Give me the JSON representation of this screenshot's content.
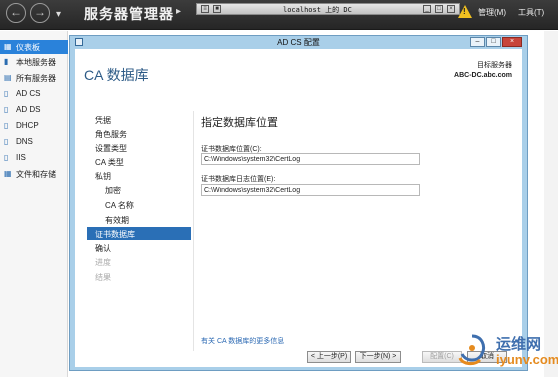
{
  "server_manager": {
    "title": "服务器管理器",
    "manage_menu": "管理(M)",
    "tools_menu": "工具(T)",
    "sidebar": [
      {
        "label": "仪表板",
        "icon": "dashboard-icon",
        "active": true
      },
      {
        "label": "本地服务器",
        "icon": "server-icon",
        "active": false
      },
      {
        "label": "所有服务器",
        "icon": "servers-icon",
        "active": false
      },
      {
        "label": "AD CS",
        "icon": "role-icon",
        "active": false
      },
      {
        "label": "AD DS",
        "icon": "role-icon",
        "active": false
      },
      {
        "label": "DHCP",
        "icon": "role-icon",
        "active": false
      },
      {
        "label": "DNS",
        "icon": "role-icon",
        "active": false
      },
      {
        "label": "IIS",
        "icon": "role-icon",
        "active": false
      },
      {
        "label": "文件和存储",
        "icon": "storage-icon",
        "active": false
      }
    ]
  },
  "remote_session": {
    "title": "localhost 上的 DC"
  },
  "dialog": {
    "title": "AD CS 配置",
    "heading": "CA 数据库",
    "target_label": "目标服务器",
    "target_value": "ABC-DC.abc.com",
    "nav": [
      {
        "label": "凭据",
        "indent": 0,
        "state": "normal"
      },
      {
        "label": "角色服务",
        "indent": 0,
        "state": "normal"
      },
      {
        "label": "设置类型",
        "indent": 0,
        "state": "normal"
      },
      {
        "label": "CA 类型",
        "indent": 0,
        "state": "normal"
      },
      {
        "label": "私钥",
        "indent": 0,
        "state": "normal"
      },
      {
        "label": "加密",
        "indent": 1,
        "state": "normal"
      },
      {
        "label": "CA 名称",
        "indent": 1,
        "state": "normal"
      },
      {
        "label": "有效期",
        "indent": 1,
        "state": "normal"
      },
      {
        "label": "证书数据库",
        "indent": 0,
        "state": "active"
      },
      {
        "label": "确认",
        "indent": 0,
        "state": "normal"
      },
      {
        "label": "进度",
        "indent": 0,
        "state": "disabled"
      },
      {
        "label": "结果",
        "indent": 0,
        "state": "disabled"
      }
    ],
    "content_title": "指定数据库位置",
    "db_location_label": "证书数据库位置(C):",
    "db_location_value": "C:\\Windows\\system32\\CertLog",
    "log_location_label": "证书数据库日志位置(E):",
    "log_location_value": "C:\\Windows\\system32\\CertLog",
    "more_link": "有关 CA 数据库的更多信息",
    "buttons": {
      "prev": "< 上一步(P)",
      "next": "下一步(N) >",
      "configure": "配置(C)",
      "cancel": "取消"
    }
  },
  "watermark": {
    "text": "运维网",
    "url": "iyunv.com"
  }
}
